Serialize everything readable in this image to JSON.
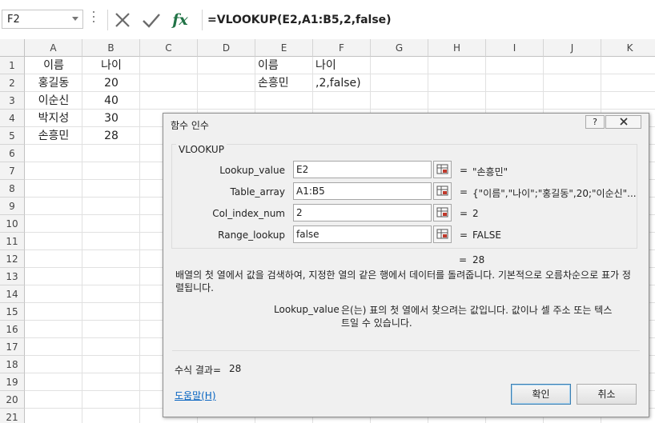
{
  "formula_bar": {
    "name_box": "F2",
    "formula": "=VLOOKUP(E2,A1:B5,2,false)",
    "fx_label": "fx"
  },
  "grid": {
    "columns": [
      "A",
      "B",
      "C",
      "D",
      "E",
      "F",
      "G",
      "H",
      "I",
      "J",
      "K"
    ],
    "rows": [
      "1",
      "2",
      "3",
      "4",
      "5",
      "6",
      "7",
      "8",
      "9",
      "10",
      "11",
      "12",
      "13",
      "14",
      "15",
      "16",
      "17",
      "18",
      "19",
      "20",
      "21"
    ],
    "cells": {
      "A1": "이름",
      "B1": "나이",
      "A2": "홍길동",
      "B2": "20",
      "A3": "이순신",
      "B3": "40",
      "A4": "박지성",
      "B4": "30",
      "A5": "손흥민",
      "B5": "28",
      "E1": "이름",
      "F1": "나이",
      "E2": "손흥민",
      "F2": ",2,false)"
    }
  },
  "dialog": {
    "title": "함수 인수",
    "help_btn": "?",
    "function_name": "VLOOKUP",
    "args": [
      {
        "label": "Lookup_value",
        "input": "E2",
        "equals": "=",
        "value": "\"손흥민\""
      },
      {
        "label": "Table_array",
        "input": "A1:B5",
        "equals": "=",
        "value": "{\"이름\",\"나이\";\"홍길동\",20;\"이순신\"..."
      },
      {
        "label": "Col_index_num",
        "input": "2",
        "equals": "=",
        "value": "2"
      },
      {
        "label": "Range_lookup",
        "input": "false",
        "equals": "=",
        "value": "FALSE"
      }
    ],
    "result_equals": "=",
    "result_value": "28",
    "description": "배열의 첫 열에서 값을 검색하여, 지정한 열의 같은 행에서 데이터를 돌려줍니다. 기본적으로 오름차순으로 표가 정렬됩니다.",
    "arg_desc_name": "Lookup_value",
    "arg_desc_text": "은(는) 표의 첫 열에서 찾으려는 값입니다. 값이나 셀 주소 또는 텍스트일 수 있습니다.",
    "formula_result_label": "수식 결과=",
    "formula_result_value": "28",
    "help_link": "도움말(H)",
    "ok_label": "확인",
    "cancel_label": "취소"
  }
}
